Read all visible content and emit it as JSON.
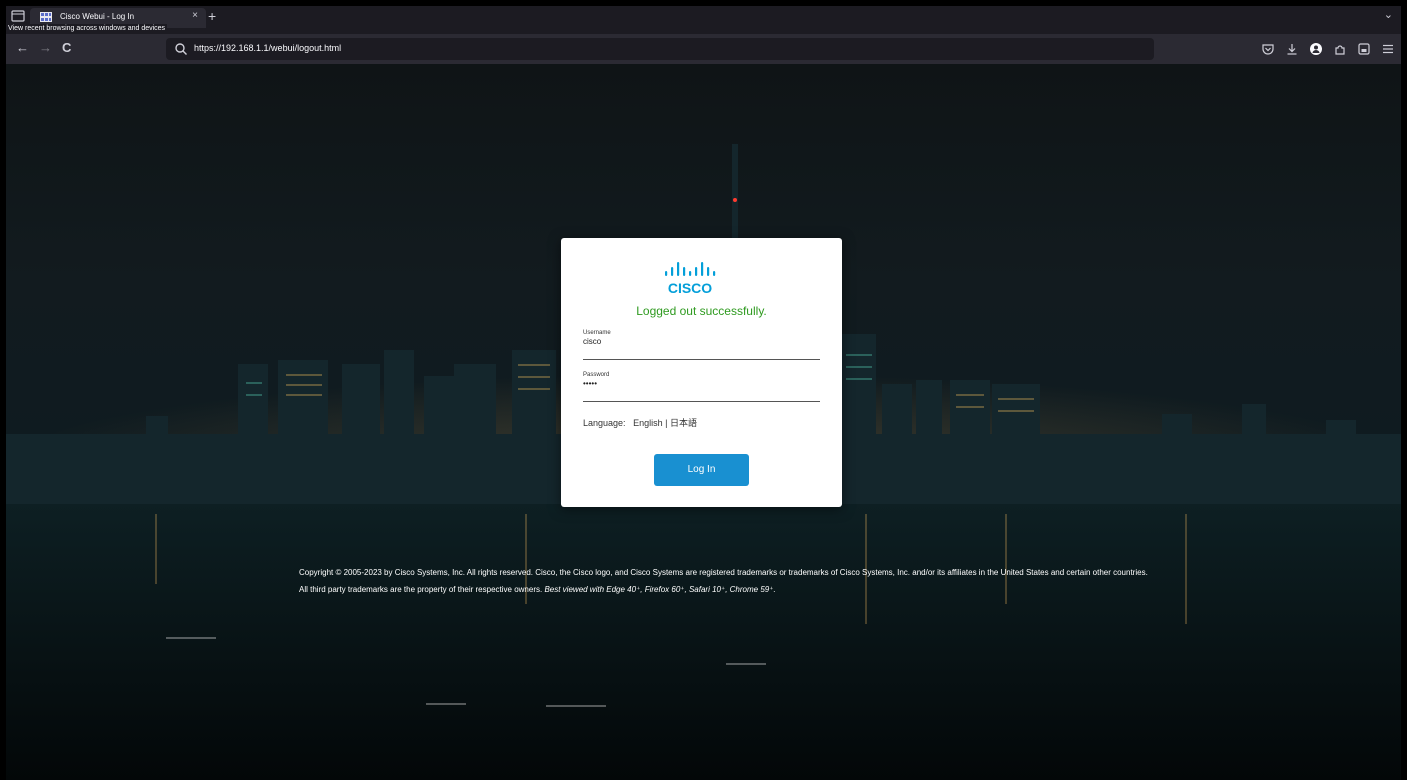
{
  "browser": {
    "recent_tooltip": "View recent browsing across windows and devices",
    "tab": {
      "title": "Cisco Webui - Log In",
      "close": "×"
    },
    "new_tab": "+",
    "tab_list": "⌄",
    "nav": {
      "back": "←",
      "forward": "→",
      "reload": "C"
    },
    "url": "https://192.168.1.1/webui/logout.html"
  },
  "login": {
    "status_message": "Logged out successfully.",
    "username": {
      "label": "Username",
      "value": "cisco"
    },
    "password": {
      "label": "Password",
      "value": "•••••"
    },
    "language_label": "Language:",
    "language_english": "English",
    "language_separator": "|",
    "language_japanese": "日本語",
    "login_button": "Log In",
    "logo_text": "CISCO"
  },
  "footer": {
    "copyright_main": "Copyright © 2005-2023 by Cisco Systems, Inc. All rights reserved. Cisco, the Cisco logo, and Cisco Systems are registered trademarks or trademarks of Cisco Systems, Inc. and/or its affiliates in the United States and certain other countries. All third party trademarks are the property of their respective owners.",
    "best_viewed": "Best viewed with Edge 40⁺, Firefox 60⁺, Safari 10⁺, Chrome 59⁺."
  },
  "colors": {
    "cisco_blue": "#049fd9",
    "success_green": "#2e9a1f",
    "login_button": "#1990d1"
  },
  "icons": {
    "tab_favicon": "grid-icon",
    "url_search": "search-icon",
    "toolbar": [
      "pocket-icon",
      "download-icon",
      "account-icon",
      "extensions-icon",
      "screenshot-icon",
      "menu-icon"
    ]
  }
}
